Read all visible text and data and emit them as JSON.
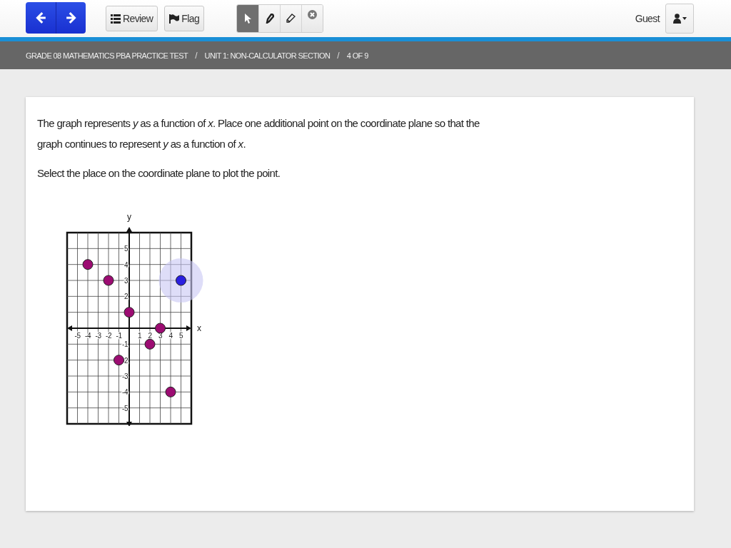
{
  "toolbar": {
    "nav": [
      {
        "kind": "back"
      },
      {
        "kind": "next"
      }
    ],
    "buttons": [
      {
        "kind": "review",
        "label": "Review"
      },
      {
        "kind": "flag",
        "label": "Flag"
      }
    ],
    "tools": [
      {
        "kind": "pointer",
        "selected": true
      },
      {
        "kind": "pen",
        "selected": false
      },
      {
        "kind": "eraser",
        "selected": false
      },
      {
        "kind": "clear",
        "selected": false
      }
    ],
    "user": {
      "name": "Guest"
    }
  },
  "breadcrumb": [
    {
      "kind": "item",
      "text": "GRADE 08 MATHEMATICS PBA PRACTICE TEST"
    },
    {
      "kind": "separator",
      "text": "/"
    },
    {
      "kind": "item",
      "text": "UNIT 1: NON-CALCULATOR SECTION"
    },
    {
      "kind": "separator",
      "text": "/"
    },
    {
      "kind": "item",
      "text": "4 OF 9"
    }
  ],
  "question": {
    "paragraphs": [
      "The graph represents *y* as a function of *x*. Place one additional point on the coordinate plane so that the graph continues to represent *y* as a function of *x*.",
      "Select the place on the coordinate plane to plot the point."
    ],
    "chart_data": {
      "type": "scatter",
      "xlabel": "x",
      "ylabel": "y",
      "xlim": [
        -6,
        6
      ],
      "ylim": [
        -6,
        6
      ],
      "grid": true,
      "xticks": [
        -5,
        -4,
        -3,
        -2,
        -1,
        1,
        2,
        3,
        4,
        5
      ],
      "yticks": [
        -5,
        -4,
        -3,
        -2,
        -1,
        1,
        2,
        3,
        4,
        5
      ],
      "series": [
        {
          "color": "#9c0c72",
          "x": [
            -4,
            -2,
            0,
            3,
            2,
            -1,
            4
          ],
          "values": [
            4,
            3,
            1,
            0,
            -1,
            -2,
            -4
          ]
        },
        {
          "color": "#2a1fe0",
          "x": [
            5
          ],
          "values": [
            3
          ]
        }
      ]
    },
    "placed_point_halo": true
  }
}
